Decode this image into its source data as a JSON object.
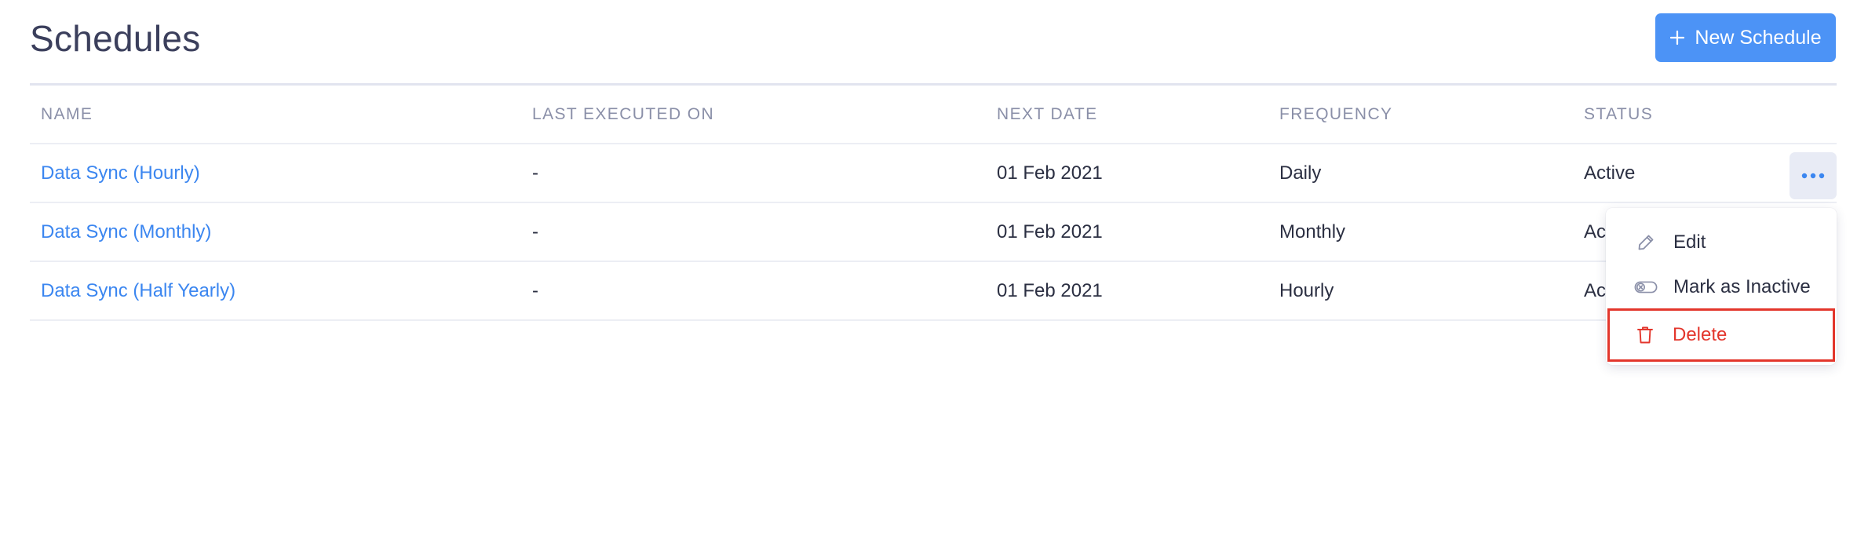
{
  "page": {
    "title": "Schedules",
    "new_button_label": "New Schedule"
  },
  "table": {
    "columns": [
      "NAME",
      "LAST EXECUTED ON",
      "NEXT DATE",
      "FREQUENCY",
      "STATUS"
    ],
    "rows": [
      {
        "name": "Data Sync (Hourly)",
        "last_executed": "-",
        "next_date": "01 Feb 2021",
        "frequency": "Daily",
        "status": "Active"
      },
      {
        "name": "Data Sync (Monthly)",
        "last_executed": "-",
        "next_date": "01 Feb 2021",
        "frequency": "Monthly",
        "status": "Active"
      },
      {
        "name": "Data Sync (Half Yearly)",
        "last_executed": "-",
        "next_date": "01 Feb 2021",
        "frequency": "Hourly",
        "status": "Active"
      }
    ]
  },
  "row_menu": {
    "items": [
      {
        "label": "Edit",
        "icon": "pencil-icon"
      },
      {
        "label": "Mark as Inactive",
        "icon": "toggle-off-icon"
      },
      {
        "label": "Delete",
        "icon": "trash-icon"
      }
    ]
  },
  "colors": {
    "accent": "#4c93f6",
    "link": "#3b86f0",
    "danger": "#e3362c"
  }
}
